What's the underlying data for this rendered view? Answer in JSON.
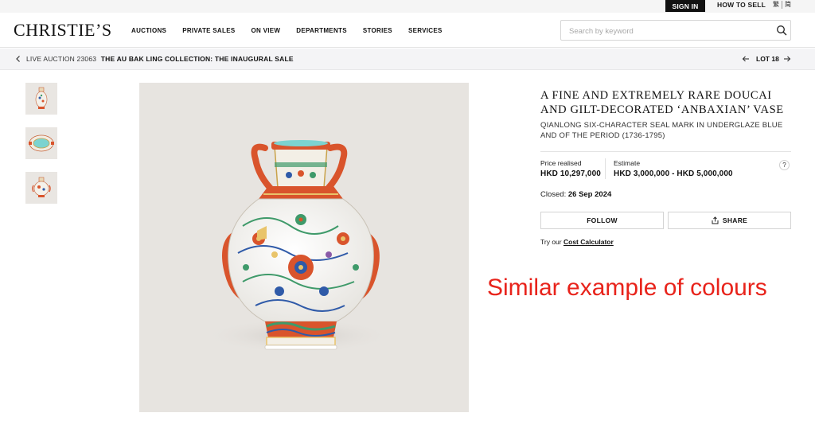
{
  "utility": {
    "sign_in": "SIGN IN",
    "how_to_sell": "HOW TO SELL",
    "lang_traditional": "繁",
    "lang_simplified": "简"
  },
  "header": {
    "logo": "CHRISTIE’S",
    "nav": [
      "AUCTIONS",
      "PRIVATE SALES",
      "ON VIEW",
      "DEPARTMENTS",
      "STORIES",
      "SERVICES"
    ],
    "search_placeholder": "Search by keyword",
    "search_value": ""
  },
  "breadcrumb": {
    "live": "LIVE AUCTION 23063",
    "sale_title": "THE AU BAK LING COLLECTION: THE INAUGURAL SALE",
    "lot": "LOT 18"
  },
  "lot": {
    "title": "A FINE AND EXTREMELY RARE DOUCAI AND GILT-DECORATED ‘ANBAXIAN’ VASE",
    "subtitle": "QIANLONG SIX-CHARACTER SEAL MARK IN UNDERGLAZE BLUE AND OF THE PERIOD (1736-1795)",
    "price_label": "Price realised",
    "price_value": "HKD 10,297,000",
    "estimate_label": "Estimate",
    "estimate_value": "HKD 3,000,000 - HKD 5,000,000",
    "help": "?",
    "closed_label": "Closed:",
    "closed_date": "26 Sep 2024",
    "follow": "FOLLOW",
    "share": "SHARE",
    "calc_prefix": "Try our",
    "calc_link": "Cost Calculator"
  },
  "annotation": "Similar example of colours",
  "colors": {
    "annotation": "#e8231b",
    "vase_red": "#d9542c",
    "vase_blue": "#2f5aa8",
    "vase_green": "#3f9a6a",
    "turquoise": "#7cd3d0"
  }
}
